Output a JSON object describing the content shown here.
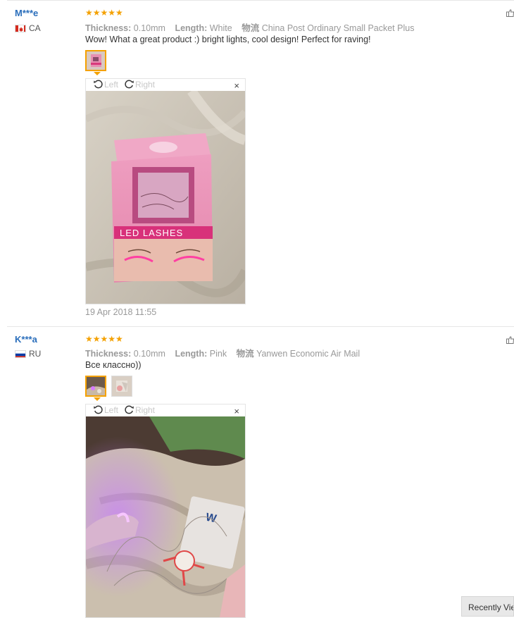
{
  "reviews": [
    {
      "user": "M***e",
      "country_code": "CA",
      "stars": "★★★★★",
      "thickness_label": "Thickness:",
      "thickness_value": "0.10mm",
      "length_label": "Length:",
      "length_value": "White",
      "logistics_label": "物流",
      "logistics_value": "China Post Ordinary Small Packet Plus",
      "feedback": "Wow! What a great product :) bright lights, cool design! Perfect for raving!",
      "rotate_left": "Left",
      "rotate_right": "Right",
      "close": "×",
      "photo_box_text": "LED LASHES",
      "date": "19 Apr 2018 11:55"
    },
    {
      "user": "K***a",
      "country_code": "RU",
      "stars": "★★★★★",
      "thickness_label": "Thickness:",
      "thickness_value": "0.10mm",
      "length_label": "Length:",
      "length_value": "Pink",
      "logistics_label": "物流",
      "logistics_value": "Yanwen Economic Air Mail",
      "feedback": "Все классно))",
      "rotate_left": "Left",
      "rotate_right": "Right",
      "close": "×"
    }
  ],
  "recently_viewed": "Recently Viewed",
  "colors": {
    "username": "#2a6ebb",
    "stars": "#f4a100",
    "meta": "#999999"
  }
}
